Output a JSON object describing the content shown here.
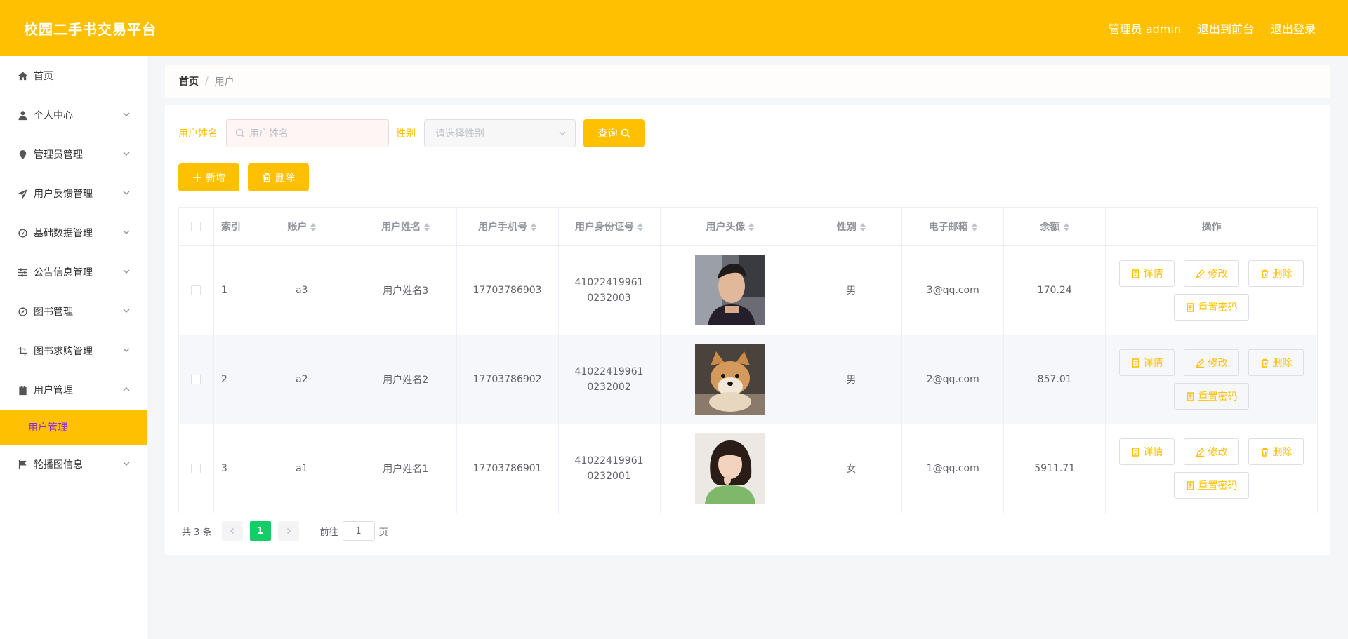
{
  "header": {
    "brand": "校园二手书交易平台",
    "admin_label": "管理员 admin",
    "to_front": "退出到前台",
    "logout": "退出登录"
  },
  "sidebar": {
    "items": [
      {
        "label": "首页",
        "icon": "home-icon"
      },
      {
        "label": "个人中心",
        "icon": "user-icon"
      },
      {
        "label": "管理员管理",
        "icon": "pin-icon"
      },
      {
        "label": "用户反馈管理",
        "icon": "send-icon"
      },
      {
        "label": "基础数据管理",
        "icon": "gauge-icon"
      },
      {
        "label": "公告信息管理",
        "icon": "sliders-icon"
      },
      {
        "label": "图书管理",
        "icon": "compass-icon"
      },
      {
        "label": "图书求购管理",
        "icon": "crop-icon"
      },
      {
        "label": "用户管理",
        "icon": "clipboard-icon"
      },
      {
        "label": "轮播图信息",
        "icon": "flag-icon"
      }
    ],
    "active_sub": "用户管理"
  },
  "breadcrumb": {
    "home": "首页",
    "sep": "/",
    "current": "用户"
  },
  "search": {
    "name_label": "用户姓名",
    "name_placeholder": "用户姓名",
    "gender_label": "性别",
    "gender_placeholder": "请选择性别",
    "query_label": "查询"
  },
  "actions": {
    "add_label": "新增",
    "delete_label": "删除"
  },
  "table": {
    "headers": [
      "索引",
      "账户",
      "用户姓名",
      "用户手机号",
      "用户身份证号",
      "用户头像",
      "性别",
      "电子邮箱",
      "余额",
      "操作"
    ],
    "rows": [
      {
        "index": "1",
        "account": "a3",
        "name": "用户姓名3",
        "phone": "17703786903",
        "idcard": "410224199610232003",
        "avatar": "young-man-photo",
        "gender": "男",
        "email": "3@qq.com",
        "balance": "170.24"
      },
      {
        "index": "2",
        "account": "a2",
        "name": "用户姓名2",
        "phone": "17703786902",
        "idcard": "410224199610232002",
        "avatar": "shiba-dog-photo",
        "gender": "男",
        "email": "2@qq.com",
        "balance": "857.01"
      },
      {
        "index": "3",
        "account": "a1",
        "name": "用户姓名1",
        "phone": "17703786901",
        "idcard": "410224199610232001",
        "avatar": "young-woman-photo",
        "gender": "女",
        "email": "1@qq.com",
        "balance": "5911.71"
      }
    ],
    "ops": {
      "detail": "详情",
      "edit": "修改",
      "delete": "删除",
      "reset": "重置密码"
    }
  },
  "pagination": {
    "total": "共 3 条",
    "current_page": "1",
    "goto_prefix": "前往",
    "goto_value": "1",
    "goto_suffix": "页"
  },
  "colors": {
    "accent": "#fec000",
    "active_text": "#8a2be2",
    "page_active": "#13ce66"
  }
}
